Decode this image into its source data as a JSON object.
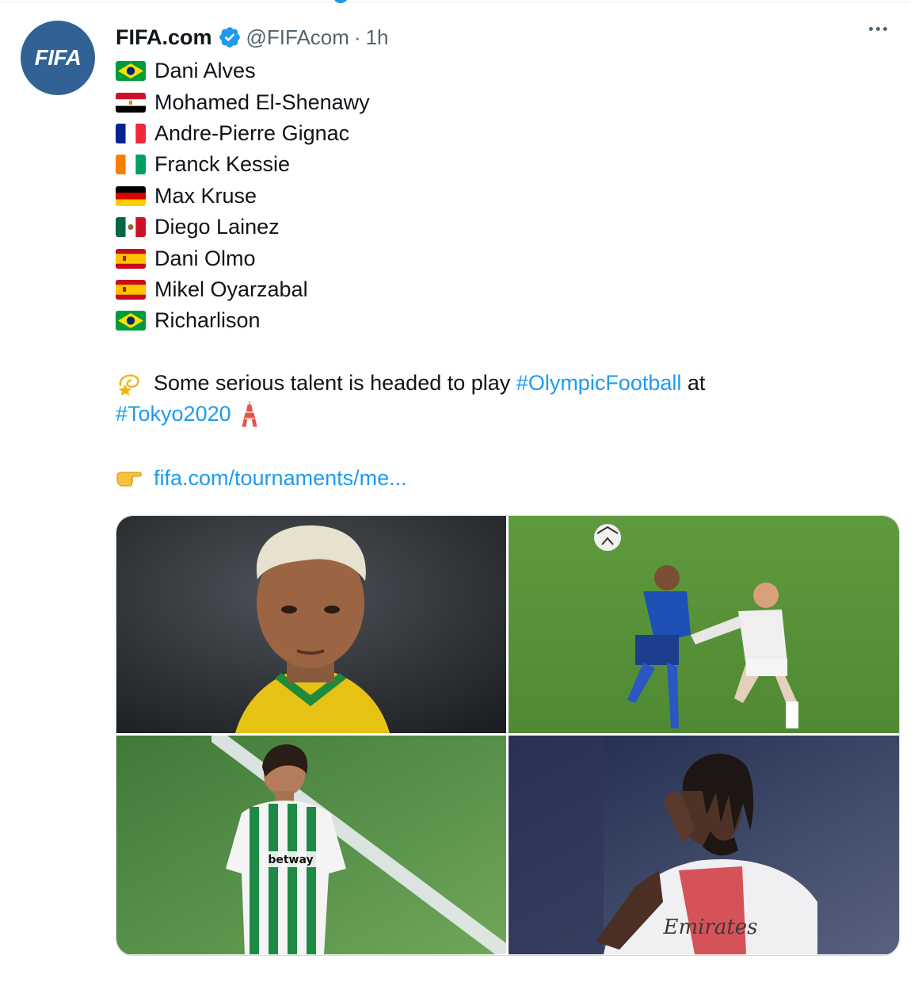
{
  "tweet": {
    "author": {
      "name": "FIFA.com",
      "handle": "@FIFAcom",
      "avatar_text": "FIFA",
      "verified": true
    },
    "separator": "·",
    "time": "1h",
    "players": [
      {
        "flag": "brazil",
        "name": "Dani Alves"
      },
      {
        "flag": "egypt",
        "name": "Mohamed El-Shenawy"
      },
      {
        "flag": "france",
        "name": "Andre-Pierre Gignac"
      },
      {
        "flag": "ivory-coast",
        "name": "Franck Kessie"
      },
      {
        "flag": "germany",
        "name": "Max Kruse"
      },
      {
        "flag": "mexico",
        "name": "Diego Lainez"
      },
      {
        "flag": "spain",
        "name": "Dani Olmo"
      },
      {
        "flag": "spain",
        "name": "Mikel Oyarzabal"
      },
      {
        "flag": "brazil",
        "name": "Richarlison"
      }
    ],
    "message": {
      "emoji": "dizzy-star-icon",
      "text": "Some serious talent is headed to play",
      "hashtag1": "#OlympicFootball",
      "connector": "at",
      "hashtag2": "#Tokyo2020",
      "emoji2": "tokyo-tower-icon"
    },
    "link": {
      "emoji": "pointing-hand-icon",
      "text": "fifa.com/tournaments/me..."
    },
    "media": [
      {
        "name": "photo-player-yellow-jersey"
      },
      {
        "name": "photo-match-action"
      },
      {
        "name": "photo-player-green-white-jersey",
        "shirt_text": "betway"
      },
      {
        "name": "photo-player-celebrating",
        "shirt_text": "Emirates"
      }
    ]
  },
  "colors": {
    "accent": "#1d9bf0",
    "text": "#0f1419",
    "muted": "#536471",
    "avatar_bg": "#326295"
  }
}
